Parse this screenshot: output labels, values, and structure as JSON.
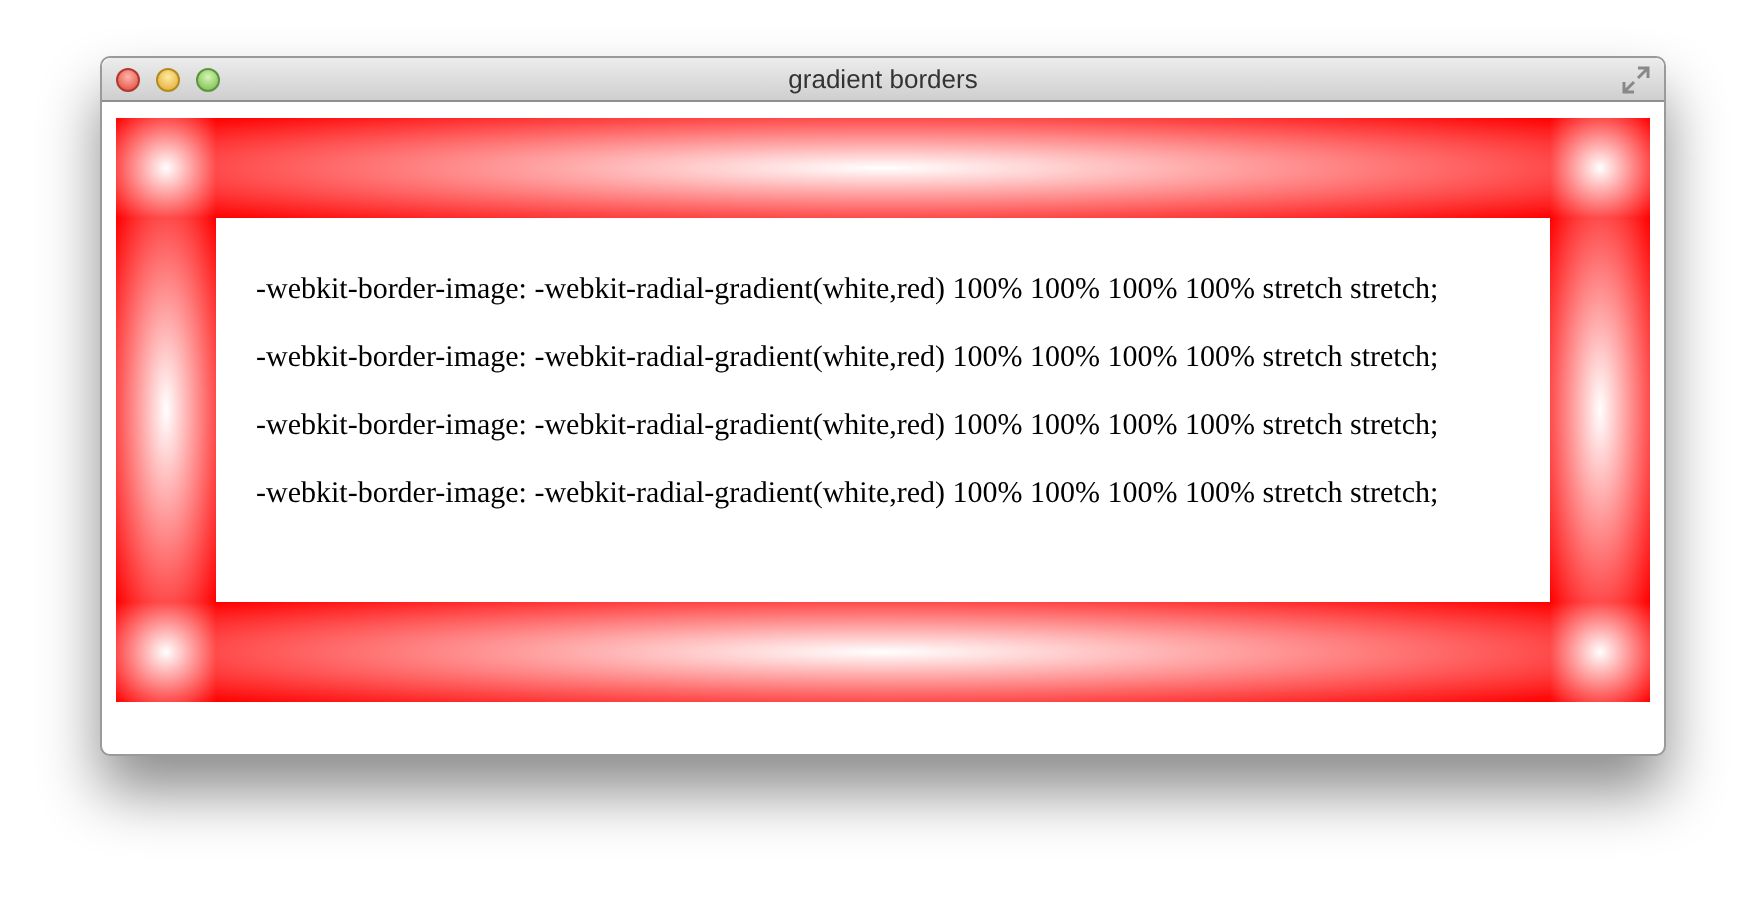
{
  "window": {
    "title": "gradient borders"
  },
  "lines": [
    "-webkit-border-image: -webkit-radial-gradient(white,red) 100% 100% 100% 100% stretch stretch;",
    "-webkit-border-image: -webkit-radial-gradient(white,red) 100% 100% 100% 100% stretch stretch;",
    "-webkit-border-image: -webkit-radial-gradient(white,red) 100% 100% 100% 100% stretch stretch;",
    "-webkit-border-image: -webkit-radial-gradient(white,red) 100% 100% 100% 100% stretch stretch;"
  ]
}
